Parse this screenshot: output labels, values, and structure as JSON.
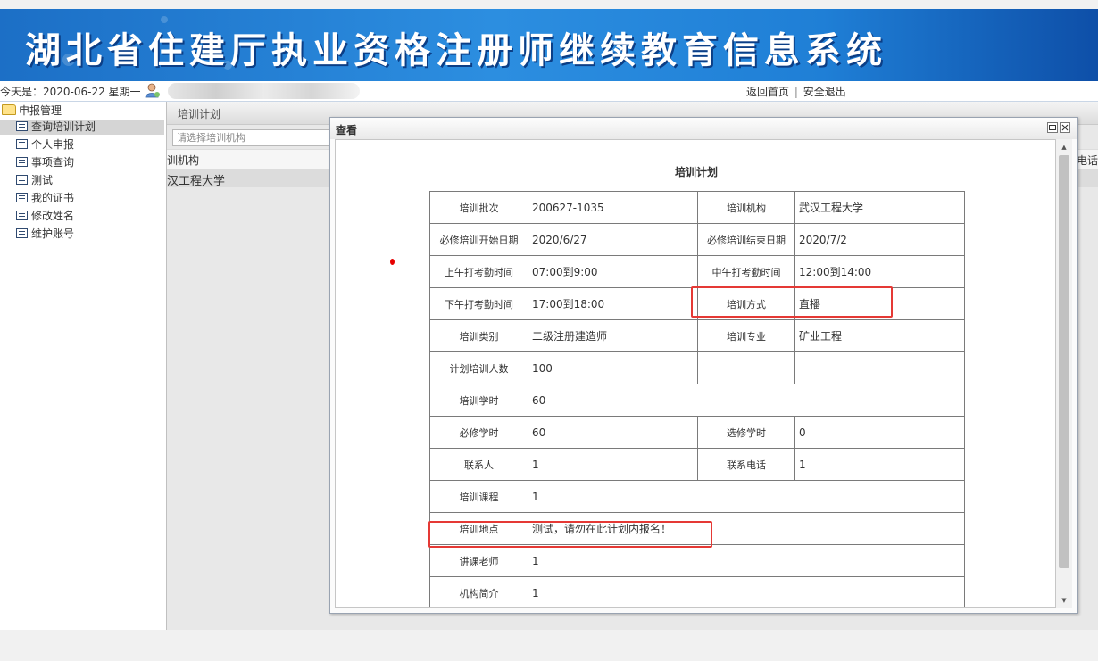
{
  "header": {
    "title": "湖北省住建厅执业资格注册师继续教育信息系统"
  },
  "infobar": {
    "date_text": "今天是：2020-06-22 星期一",
    "home_link": "返回首页",
    "separator": "|",
    "logout_link": "安全退出"
  },
  "sidebar": {
    "root": "申报管理",
    "items": [
      {
        "label": "查询培训计划",
        "selected": true
      },
      {
        "label": "个人申报"
      },
      {
        "label": "事项查询"
      },
      {
        "label": "测试"
      },
      {
        "label": "我的证书"
      },
      {
        "label": "修改姓名"
      },
      {
        "label": "维护账号"
      }
    ]
  },
  "main": {
    "panel_title": "培训计划",
    "search_placeholder": "请选择培训机构",
    "column_left": "训机构",
    "column_right": "电话",
    "row_text": "汉工程大学"
  },
  "dialog": {
    "title": "查看",
    "doc_title": "培训计划",
    "rows": [
      {
        "l1": "培训批次",
        "v1": "200627-1035",
        "l2": "培训机构",
        "v2": "武汉工程大学"
      },
      {
        "l1": "必修培训开始日期",
        "v1": "2020/6/27",
        "l2": "必修培训结束日期",
        "v2": "2020/7/2"
      },
      {
        "l1": "上午打考勤时间",
        "v1": "07:00到9:00",
        "l2": "中午打考勤时间",
        "v2": "12:00到14:00"
      },
      {
        "l1": "下午打考勤时间",
        "v1": "17:00到18:00",
        "l2": "培训方式",
        "v2": "直播"
      },
      {
        "l1": "培训类别",
        "v1": "二级注册建造师",
        "l2": "培训专业",
        "v2": "矿业工程"
      },
      {
        "l1": "计划培训人数",
        "v1": "100",
        "l2": "",
        "v2": ""
      },
      {
        "l1": "培训学时",
        "v1": "60"
      },
      {
        "l1": "必修学时",
        "v1": "60",
        "l2": "选修学时",
        "v2": "0"
      },
      {
        "l1": "联系人",
        "v1": "1",
        "l2": "联系电话",
        "v2": "1"
      },
      {
        "l1": "培训课程",
        "v1": "1"
      },
      {
        "l1": "培训地点",
        "v1": "测试，请勿在此计划内报名！"
      },
      {
        "l1": "讲课老师",
        "v1": "1"
      },
      {
        "l1": "机构简介",
        "v1": "1"
      }
    ]
  },
  "colors": {
    "header_blue": "#1f7fd6",
    "highlight_red": "#e53935"
  },
  "icons": {
    "restore": "restore-icon",
    "close": "close-icon",
    "folder": "folder-icon",
    "user": "user-icon"
  }
}
